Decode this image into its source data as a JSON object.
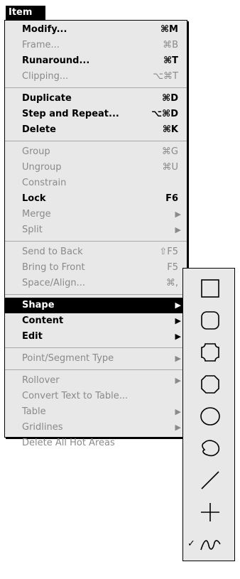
{
  "menubar": {
    "title": "Item"
  },
  "menu": {
    "groups": [
      [
        {
          "label": "Modify...",
          "shortcut": "⌘M",
          "enabled": true
        },
        {
          "label": "Frame...",
          "shortcut": "⌘B",
          "enabled": false
        },
        {
          "label": "Runaround...",
          "shortcut": "⌘T",
          "enabled": true
        },
        {
          "label": "Clipping...",
          "shortcut": "⌥⌘T",
          "enabled": false
        }
      ],
      [
        {
          "label": "Duplicate",
          "shortcut": "⌘D",
          "enabled": true
        },
        {
          "label": "Step and Repeat...",
          "shortcut": "⌥⌘D",
          "enabled": true
        },
        {
          "label": "Delete",
          "shortcut": "⌘K",
          "enabled": true
        }
      ],
      [
        {
          "label": "Group",
          "shortcut": "⌘G",
          "enabled": false
        },
        {
          "label": "Ungroup",
          "shortcut": "⌘U",
          "enabled": false
        },
        {
          "label": "Constrain",
          "shortcut": "",
          "enabled": false
        },
        {
          "label": "Lock",
          "shortcut": "F6",
          "enabled": true
        },
        {
          "label": "Merge",
          "shortcut": "",
          "enabled": false,
          "submenu": true
        },
        {
          "label": "Split",
          "shortcut": "",
          "enabled": false,
          "submenu": true
        }
      ],
      [
        {
          "label": "Send to Back",
          "shortcut": "⇧F5",
          "enabled": false
        },
        {
          "label": "Bring to Front",
          "shortcut": "F5",
          "enabled": false
        },
        {
          "label": "Space/Align...",
          "shortcut": "⌘,",
          "enabled": false
        }
      ],
      [
        {
          "label": "Shape",
          "shortcut": "",
          "enabled": true,
          "submenu": true,
          "highlighted": true
        },
        {
          "label": "Content",
          "shortcut": "",
          "enabled": true,
          "submenu": true
        },
        {
          "label": "Edit",
          "shortcut": "",
          "enabled": true,
          "submenu": true
        }
      ],
      [
        {
          "label": "Point/Segment Type",
          "shortcut": "",
          "enabled": false,
          "submenu": true
        }
      ],
      [
        {
          "label": "Rollover",
          "shortcut": "",
          "enabled": false,
          "submenu": true
        },
        {
          "label": "Convert Text to Table...",
          "shortcut": "",
          "enabled": false
        },
        {
          "label": "Table",
          "shortcut": "",
          "enabled": false,
          "submenu": true
        },
        {
          "label": "Gridlines",
          "shortcut": "",
          "enabled": false,
          "submenu": true
        },
        {
          "label": "Delete All Hot Areas",
          "shortcut": "",
          "enabled": false
        }
      ]
    ]
  },
  "shape_submenu": {
    "items": [
      {
        "icon": "rectangle-icon",
        "checked": false
      },
      {
        "icon": "rounded-rectangle-icon",
        "checked": false
      },
      {
        "icon": "concave-corner-rectangle-icon",
        "checked": false
      },
      {
        "icon": "beveled-corner-rectangle-icon",
        "checked": false
      },
      {
        "icon": "oval-icon",
        "checked": false
      },
      {
        "icon": "bezier-box-icon",
        "checked": false
      },
      {
        "icon": "line-icon",
        "checked": false
      },
      {
        "icon": "orthogonal-line-icon",
        "checked": false
      },
      {
        "icon": "bezier-line-icon",
        "checked": true
      }
    ],
    "check_glyph": "✓"
  },
  "colors": {
    "menu_bg": "#e8e8e8",
    "highlight": "#000000",
    "disabled": "#8a8a8a"
  }
}
